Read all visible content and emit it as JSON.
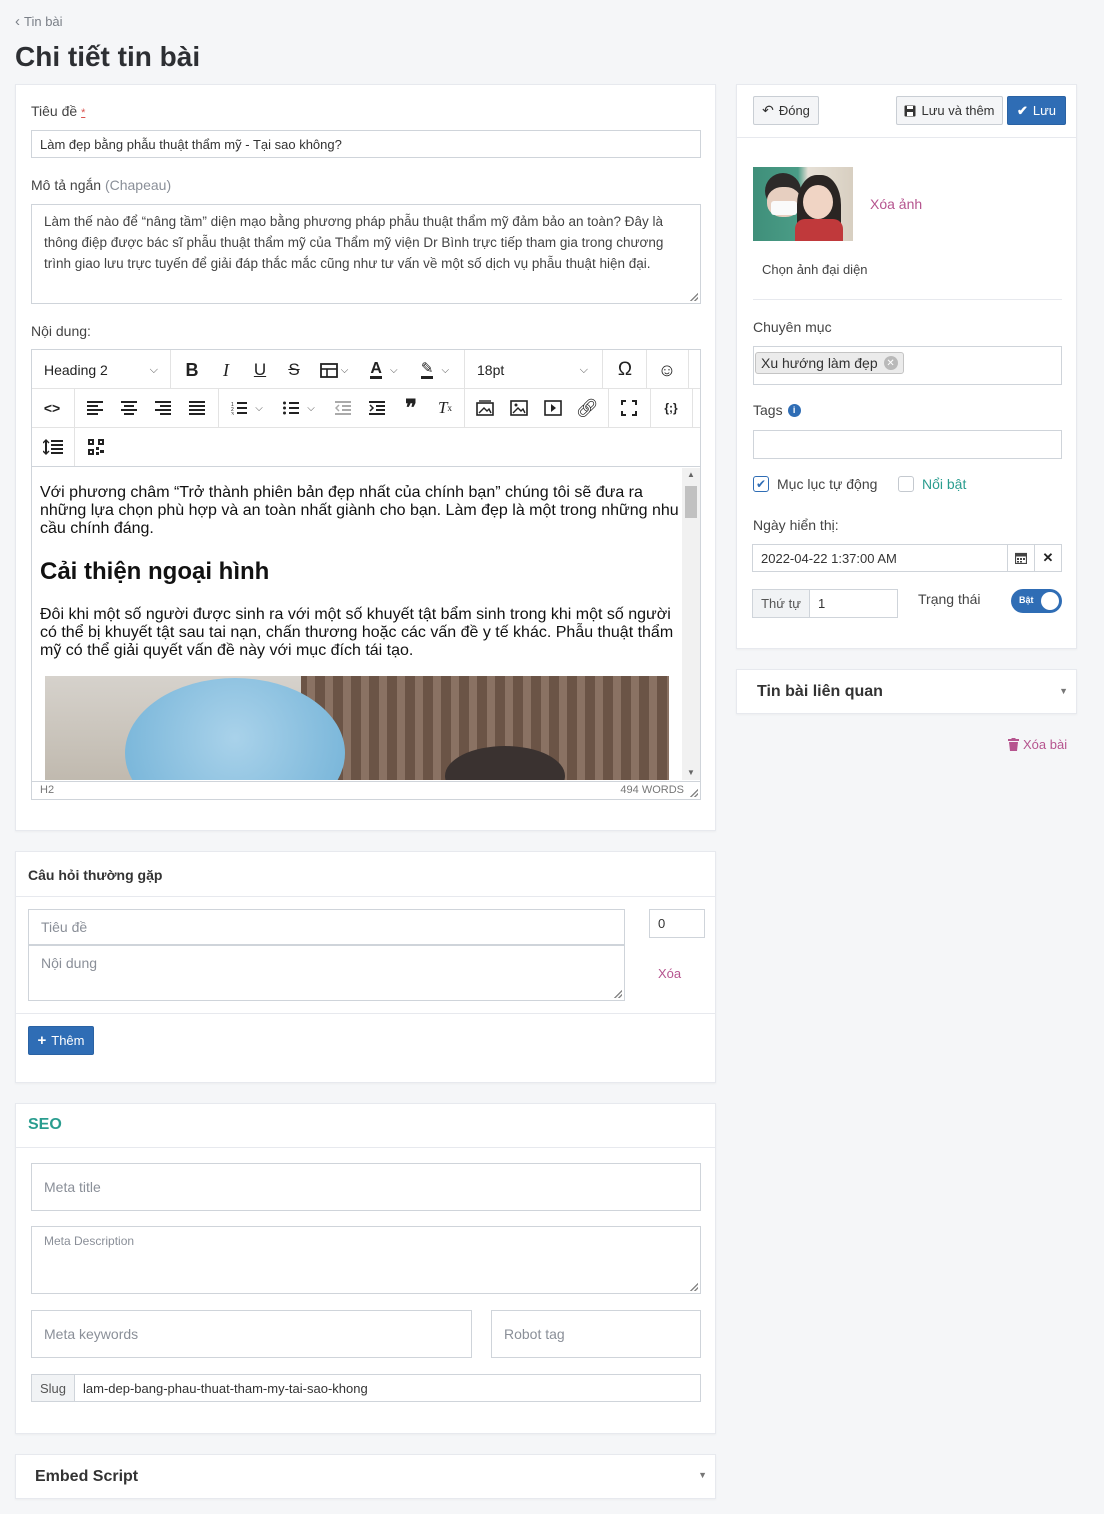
{
  "breadcrumb": {
    "back_label": "Tin bài"
  },
  "page_title": "Chi tiết tin bài",
  "form": {
    "title_label": "Tiêu đề",
    "required_mark": "*",
    "title_value": "Làm đẹp bằng phẫu thuật thẩm mỹ - Tại sao không?",
    "summary_label": "Mô tả ngắn",
    "summary_hint": "(Chapeau)",
    "summary_value": "Làm thế nào để “nâng tầm” diện mạo bằng phương pháp phẫu thuật thẩm mỹ đảm bảo an toàn? Đây là thông điệp được bác sĩ phẫu thuật thẩm mỹ của Thẩm mỹ viện Dr Bình trực tiếp tham gia trong chương trình giao lưu trực tuyến để giải đáp thắc mắc cũng như tư vấn về một số dịch vụ phẫu thuật hiện đại.",
    "content_label": "Nội dung:"
  },
  "editor": {
    "block_format": "Heading 2",
    "font_size": "18pt",
    "paragraph1": "Với phương châm “Trở thành phiên bản đẹp nhất của chính bạn” chúng tôi sẽ đưa ra những lựa chọn phù hợp và an toàn nhất giành cho bạn. Làm đẹp là một trong những nhu cầu chính đáng.",
    "heading": "Cải thiện ngoại hình",
    "paragraph2": "Đôi khi một số người được sinh ra với một số khuyết tật bẩm sinh trong khi một số người có thể bị khuyết tật sau tai nạn, chấn thương hoặc các vấn đề y tế khác. Phẫu thuật thẩm mỹ có thể giải quyết vấn đề này với mục đích tái tạo.",
    "status_path": "H2",
    "word_count": "494 WORDS",
    "icons": [
      "bold-icon",
      "italic-icon",
      "underline-icon",
      "strikethrough-icon",
      "table-icon",
      "font-color-icon",
      "highlight-icon",
      "special-char-icon",
      "emoji-icon",
      "code-icon",
      "align-left-icon",
      "align-center-icon",
      "align-right-icon",
      "align-justify-icon",
      "numbered-list-icon",
      "bullet-list-icon",
      "outdent-icon",
      "indent-icon",
      "blockquote-icon",
      "clear-format-icon",
      "image-gallery-icon",
      "image-icon",
      "media-icon",
      "link-icon",
      "fullscreen-icon",
      "template-icon",
      "line-height-icon",
      "qr-icon"
    ]
  },
  "faq": {
    "title": "Câu hỏi thường gặp",
    "question_placeholder": "Tiêu đề",
    "answer_placeholder": "Nội dung",
    "order_value": "0",
    "delete_label": "Xóa",
    "add_label": "Thêm"
  },
  "seo": {
    "title": "SEO",
    "meta_title_placeholder": "Meta title",
    "meta_description_placeholder": "Meta Description",
    "meta_keywords_placeholder": "Meta keywords",
    "robot_tag_placeholder": "Robot tag",
    "slug_label": "Slug",
    "slug_value": "lam-dep-bang-phau-thuat-tham-my-tai-sao-khong"
  },
  "embed": {
    "title": "Embed Script"
  },
  "sidebar": {
    "close_label": "Đóng",
    "save_and_add_label": "Lưu và thêm",
    "save_label": "Lưu",
    "delete_image_label": "Xóa ảnh",
    "choose_image_label": "Chọn ảnh đại diện",
    "category_label": "Chuyên mục",
    "category_tag": "Xu hướng làm đẹp",
    "tags_label": "Tags",
    "auto_toc_label": "Mục lục tự động",
    "auto_toc_checked": true,
    "featured_label": "Nổi bật",
    "featured_checked": false,
    "display_date_label": "Ngày hiển thị:",
    "display_date_value": "2022-04-22 1:37:00 AM",
    "order_label": "Thứ tự",
    "order_value": "1",
    "status_label": "Trạng thái",
    "status_toggle_label": "Bật",
    "status_on": true,
    "related_title": "Tin bài liên quan",
    "delete_post_label": "Xóa bài"
  },
  "colors": {
    "primary": "#2f6db5",
    "pink": "#b6558f",
    "green": "#2a9d8f"
  }
}
